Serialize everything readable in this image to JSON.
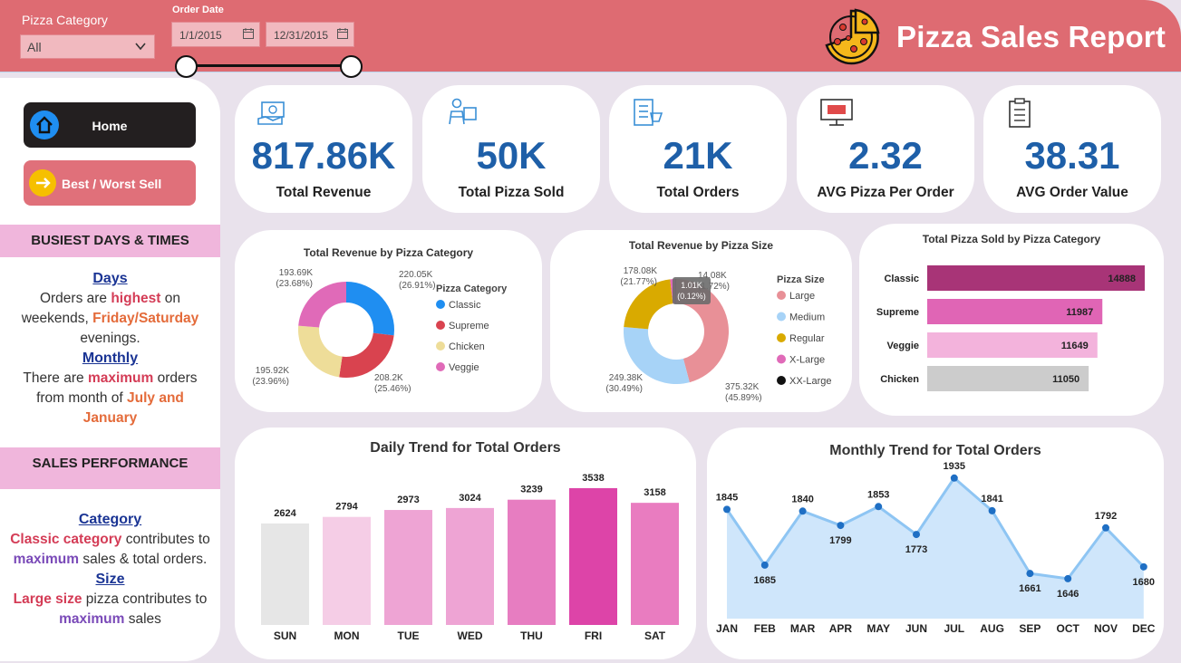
{
  "filters": {
    "category_label": "Pizza Category",
    "category_value": "All",
    "date_label": "Order Date",
    "start_date": "1/1/2015",
    "end_date": "12/31/2015"
  },
  "title": "Pizza Sales Report",
  "nav": {
    "home": "Home",
    "best_worst": "Best / Worst Sell"
  },
  "busiest": {
    "heading": "BUSIEST DAYS & TIMES",
    "days_title": "Days",
    "days_t1": "Orders are ",
    "days_hl1": "highest",
    "days_t2": " on weekends, ",
    "days_hl2": "Friday/Saturday",
    "days_t3": " evenings.",
    "monthly_title": "Monthly",
    "monthly_t1": "There are ",
    "monthly_hl1": "maximum",
    "monthly_t2": " orders from month of ",
    "monthly_hl2": "July and January"
  },
  "performance": {
    "heading": "SALES PERFORMANCE",
    "category_title": "Category",
    "cat_hl1": "Classic category",
    "cat_t1": " contributes to ",
    "cat_hl2": "maximum",
    "cat_t2": " sales & total orders.",
    "size_title": "Size",
    "size_hl1": "Large size",
    "size_t1": " pizza contributes to ",
    "size_hl2": "maximum",
    "size_t2": " sales"
  },
  "kpis": [
    {
      "value": "817.86K",
      "label": "Total Revenue"
    },
    {
      "value": "50K",
      "label": "Total Pizza Sold"
    },
    {
      "value": "21K",
      "label": "Total Orders"
    },
    {
      "value": "2.32",
      "label": "AVG Pizza Per Order"
    },
    {
      "value": "38.31",
      "label": "AVG Order Value"
    }
  ],
  "colors": {
    "header": "#de6b72",
    "kpi_value": "#1e5fa8",
    "home_btn": "#231f20",
    "best_btn": "#e0707a"
  },
  "chart_data": [
    {
      "type": "pie",
      "title": "Total Revenue by Pizza Category",
      "legend_title": "Pizza Category",
      "labels": [
        "Classic",
        "Supreme",
        "Chicken",
        "Veggie"
      ],
      "values": [
        220.05,
        208.2,
        195.92,
        193.69
      ],
      "value_labels": [
        "220.05K",
        "208.2K",
        "195.92K",
        "193.69K"
      ],
      "percent_labels": [
        "(26.91%)",
        "(25.46%)",
        "(23.96%)",
        "(23.68%)"
      ],
      "colors": [
        "#1f8ef1",
        "#d9434f",
        "#eedd99",
        "#e06ab8"
      ]
    },
    {
      "type": "pie",
      "title": "Total Revenue by Pizza Size",
      "legend_title": "Pizza Size",
      "labels": [
        "Large",
        "Medium",
        "Regular",
        "X-Large",
        "XX-Large"
      ],
      "values": [
        375.32,
        249.38,
        178.08,
        14.08,
        1.01
      ],
      "value_labels": [
        "375.32K",
        "249.38K",
        "178.08K",
        "14.08K",
        "1.01K"
      ],
      "percent_labels": [
        "(45.89%)",
        "(30.49%)",
        "(21.77%)",
        "(1.72%)",
        "(0.12%)"
      ],
      "colors": [
        "#e89097",
        "#a7d3f7",
        "#d9aa00",
        "#e06ab8",
        "#111111"
      ]
    },
    {
      "type": "bar",
      "title": "Total Pizza Sold by Pizza Category",
      "categories": [
        "Classic",
        "Supreme",
        "Veggie",
        "Chicken"
      ],
      "values": [
        14888,
        11987,
        11649,
        11050
      ],
      "colors": [
        "#a83477",
        "#e065b5",
        "#f3b3dc",
        "#cccccc"
      ]
    },
    {
      "type": "bar",
      "title": "Daily Trend for Total Orders",
      "categories": [
        "SUN",
        "MON",
        "TUE",
        "WED",
        "THU",
        "FRI",
        "SAT"
      ],
      "values": [
        2624,
        2794,
        2973,
        3024,
        3239,
        3538,
        3158
      ],
      "colors": [
        "#e6e6e6",
        "#f5cde6",
        "#eea4d4",
        "#eea4d4",
        "#e77dc1",
        "#dd44a8",
        "#e97cc0"
      ]
    },
    {
      "type": "area",
      "title": "Monthly Trend for Total Orders",
      "categories": [
        "JAN",
        "FEB",
        "MAR",
        "APR",
        "MAY",
        "JUN",
        "JUL",
        "AUG",
        "SEP",
        "OCT",
        "NOV",
        "DEC"
      ],
      "values": [
        1845,
        1685,
        1840,
        1799,
        1853,
        1773,
        1935,
        1841,
        1661,
        1646,
        1792,
        1680
      ],
      "colors": [
        "#cfe6fb",
        "#8ec5f3",
        "#1f6fc4"
      ]
    }
  ]
}
